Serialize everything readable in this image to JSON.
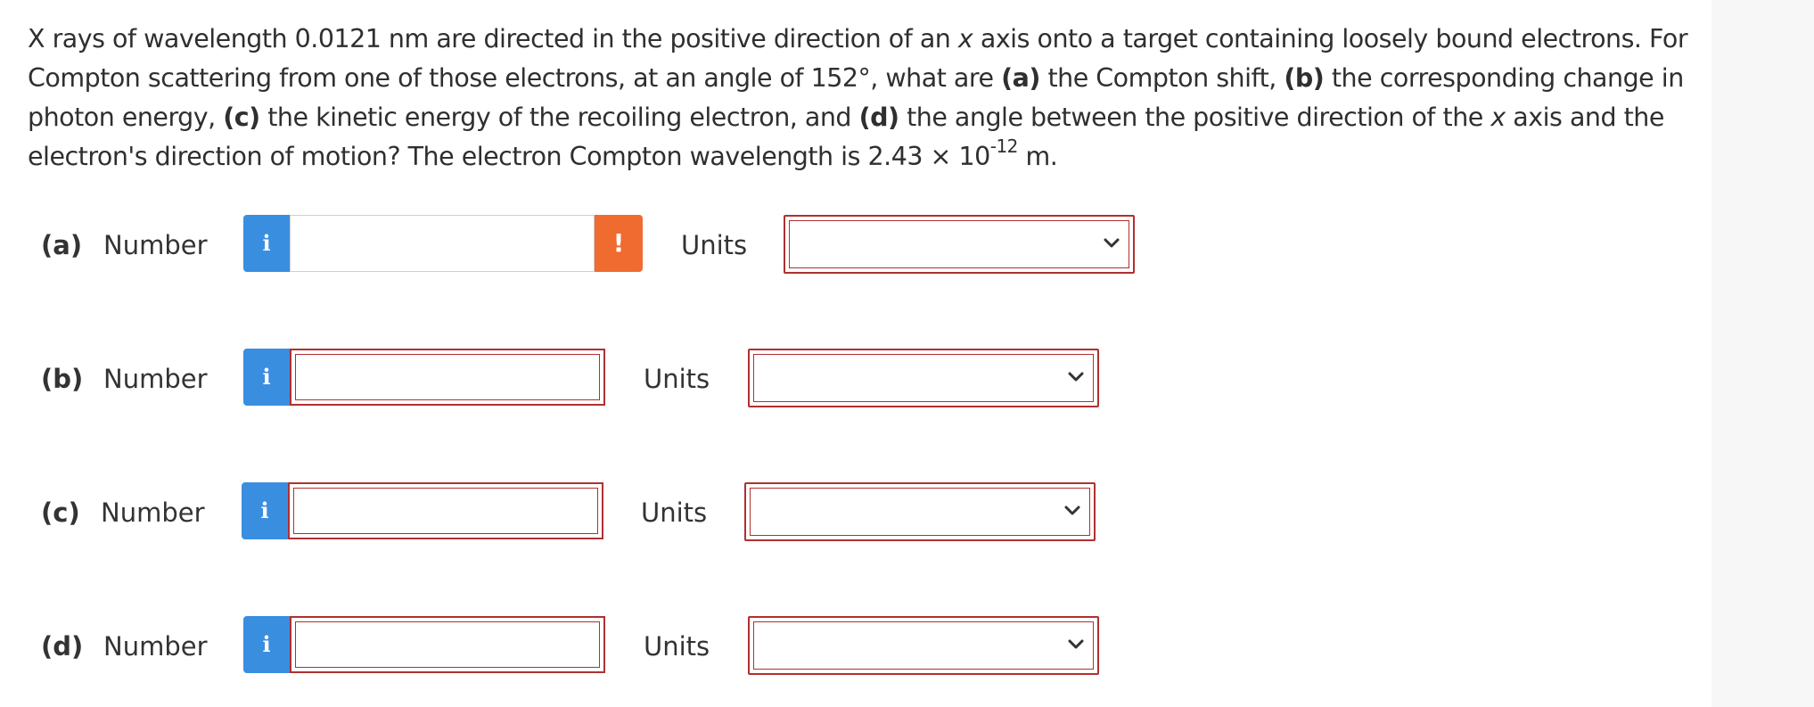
{
  "question": {
    "p1": "X rays of wavelength 0.0121 nm are directed in the positive direction of an ",
    "x1": "x",
    "p2": " axis onto a target containing loosely bound electrons. For Compton scattering from one of those electrons, at an angle of 152°, what are ",
    "a": "(a)",
    "p3": " the Compton shift, ",
    "b": "(b)",
    "p4": " the corresponding change in photon energy, ",
    "c": "(c)",
    "p5": " the kinetic energy of the recoiling electron, and ",
    "d": "(d)",
    "p6": " the angle between the positive direction of the ",
    "x2": "x",
    "p7": " axis and the electron's direction of motion? The electron Compton wavelength is 2.43 × 10",
    "exp": "-12",
    "p8": " m."
  },
  "parts": [
    {
      "label": "(a)",
      "number_label": "Number",
      "info_icon": "i",
      "value": "",
      "warning_icon": "!",
      "units_label": "Units",
      "units_value": ""
    },
    {
      "label": "(b)",
      "number_label": "Number",
      "info_icon": "i",
      "value": "",
      "units_label": "Units",
      "units_value": ""
    },
    {
      "label": "(c)",
      "number_label": "Number",
      "info_icon": "i",
      "value": "",
      "units_label": "Units",
      "units_value": ""
    },
    {
      "label": "(d)",
      "number_label": "Number",
      "info_icon": "i",
      "value": "",
      "units_label": "Units",
      "units_value": ""
    }
  ],
  "colors": {
    "info_blue": "#3a8ee0",
    "warning_orange": "#ef6b30",
    "error_border": "#b03030"
  }
}
